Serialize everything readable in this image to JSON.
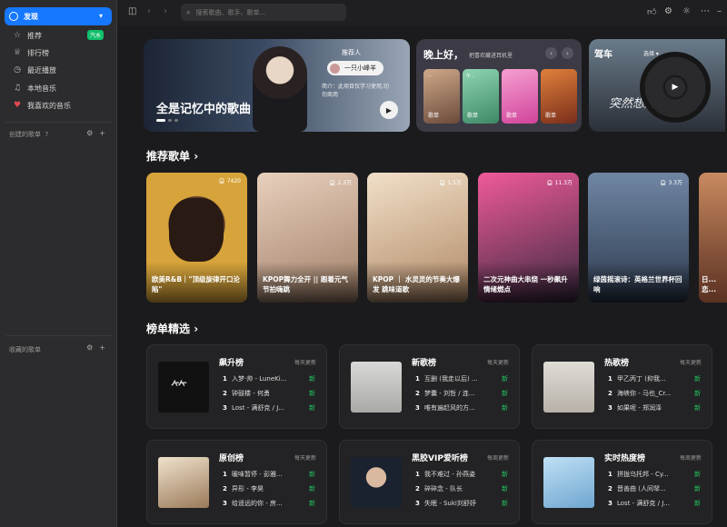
{
  "sidebar": {
    "active": "发现",
    "items": [
      "推荐",
      "排行榜",
      "最近播放",
      "本地音乐",
      "我喜欢的音乐"
    ],
    "vip_badge": "汽水",
    "created_label": "创建的歌单",
    "created_count": "?",
    "collected_label": "收藏的歌单"
  },
  "search": {
    "placeholder": "搜索歌曲、歌手、歌单..."
  },
  "banner_main": {
    "title": "全是记忆中的歌曲",
    "rec_label": "推荐人",
    "user": "一只小峰羊",
    "desc": "简介：此项目仅学习使用,切勿商用"
  },
  "banner_greet": {
    "title": "晚上好，",
    "subtitle": "把喜欢藏进耳机里",
    "minis": [
      {
        "label": "歌单",
        "tag": "..."
      },
      {
        "label": "歌单",
        "tag": "午..."
      },
      {
        "label": "歌单",
        "tag": ""
      },
      {
        "label": "歌单",
        "tag": ""
      }
    ]
  },
  "banner_fm": {
    "title": "驾车",
    "select": "选择",
    "art_text": "突然想起你"
  },
  "recommended": {
    "title": "推荐歌单",
    "items": [
      {
        "count": "7420",
        "caption": "欧美R&B｜\"顶级旋律开口沦陷\"",
        "color": "#d7a43b"
      },
      {
        "count": "2.3万",
        "caption": "KPOP舞力全开 || 跟着元气节拍嗨跳",
        "color": "#c9a78c"
      },
      {
        "count": "1.5万",
        "caption": "KPOP ｜ 水灵灵的节奏大爆发 跳味道歌",
        "color": "#d9b890"
      },
      {
        "count": "11.3万",
        "caption": "二次元神曲大串烧 一秒飙升情绪燃点",
        "color": "#c23a70"
      },
      {
        "count": "3.3万",
        "caption": "绿茵摇滚诗：英格兰世界杯回响",
        "color": "#5a6f88"
      },
      {
        "count": "",
        "caption": "日...恋...",
        "color": "#b07050"
      }
    ]
  },
  "charts": {
    "title": "榜单精选",
    "items": [
      {
        "title": "飙升榜",
        "update": "每天更新",
        "songs": [
          "入梦·帅 - LuneKi...",
          "钟鼓楼 - 何勇",
          "Lost - 满舒克 / J..."
        ]
      },
      {
        "title": "新歌榜",
        "update": "每天更新",
        "songs": [
          "互删 (我走以后) ...",
          "梦囊 - 刘哲 / 连...",
          "唯有遍赶风的方..."
        ]
      },
      {
        "title": "热歌榜",
        "update": "每天更新",
        "songs": [
          "甲乙丙丁 (抑我...",
          "海峡你 - 马也_Cr...",
          "如果呢 - 郑润泽"
        ]
      },
      {
        "title": "原创榜",
        "update": "每天更新",
        "songs": [
          "暖味暂停 - 彭雅...",
          "异形 - 李昊",
          "给遥远的你 - 房..."
        ]
      },
      {
        "title": "黑胶VIP爱听榜",
        "update": "每周更新",
        "songs": [
          "我不难过 - 孙燕姿",
          "碎碎念 - 队长",
          "失眠 - Suki刘舒妤"
        ]
      },
      {
        "title": "实时热度榜",
        "update": "每周更新",
        "songs": [
          "拼拢乌托邦 - Cy...",
          "晋善曲 (人间琴...",
          "Lost - 满舒克 / J..."
        ]
      }
    ],
    "new_label": "新"
  }
}
